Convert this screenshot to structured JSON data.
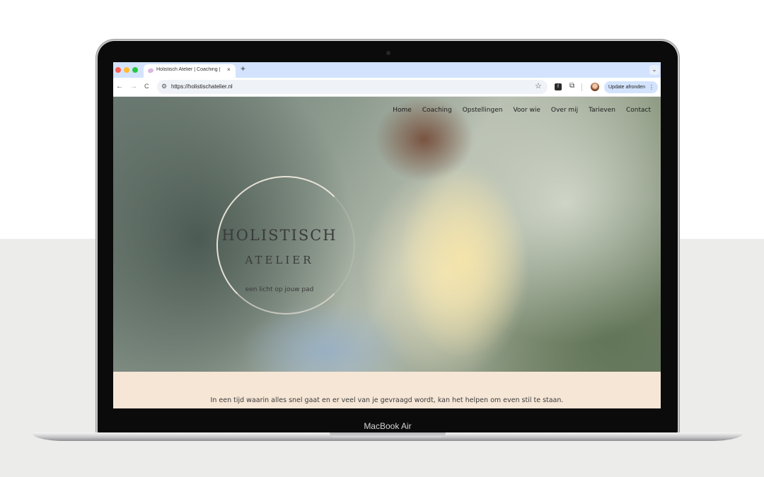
{
  "browser": {
    "tab_title": "Holistisch Atelier | Coaching |",
    "tab_close": "×",
    "new_tab": "+",
    "tab_menu": "⌄",
    "back": "←",
    "forward": "→",
    "reload": "C",
    "url": "https://holistischatelier.nl",
    "update_label": "Update afronden",
    "update_menu": "⋮",
    "icons": [
      "back-arrow-icon",
      "forward-arrow-icon",
      "reload-icon",
      "site-settings-icon",
      "bookmark-star-icon",
      "extension-icon",
      "puzzle-icon",
      "profile-avatar"
    ]
  },
  "site": {
    "nav": [
      "Home",
      "Coaching",
      "Opstellingen",
      "Voor wie",
      "Over mij",
      "Tarieven",
      "Contact"
    ],
    "logo_line1": "HOLISTISCH",
    "logo_line2": "ATELIER",
    "tagline": "een licht op jouw pad",
    "intro": "In een tijd waarin alles snel gaat en er veel van je gevraagd wordt, kan het helpen om even stil te staan."
  },
  "device": {
    "label": "MacBook Air"
  },
  "colors": {
    "tabbar": "#d3e3fd",
    "intro_bg": "#f6e6d6",
    "page_bg_bottom": "#ececea"
  }
}
